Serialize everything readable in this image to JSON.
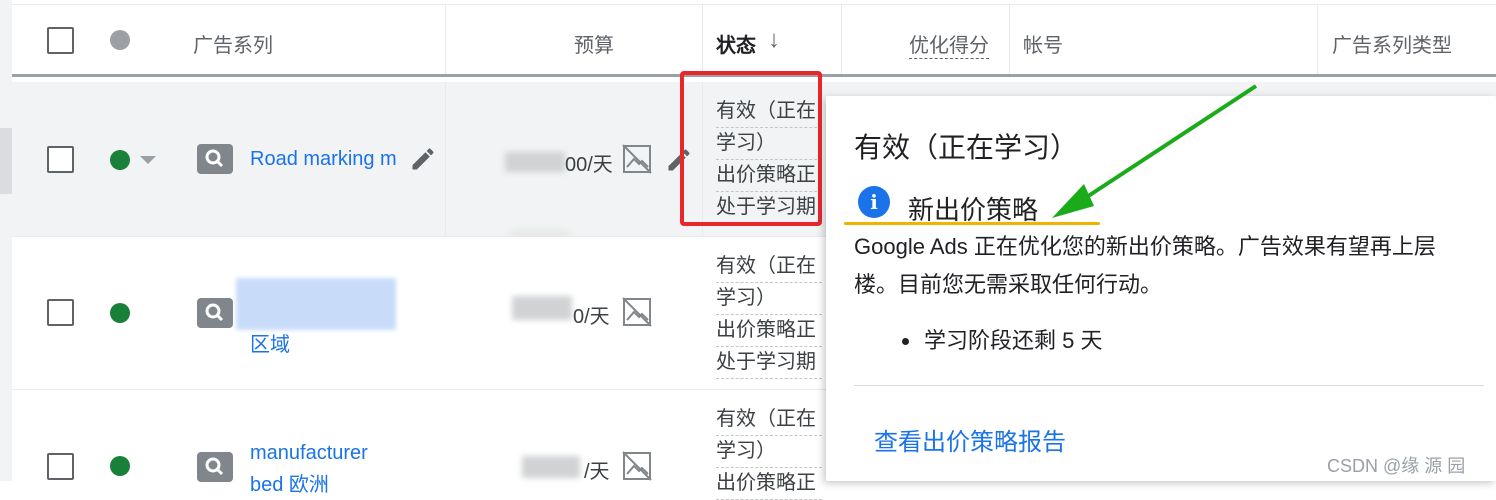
{
  "header": {
    "campaign_label": "广告系列",
    "budget_label": "预算",
    "status_label": "状态",
    "status_sort_glyph": "↓",
    "opt_score_label": "优化得分",
    "account_label": "帐号",
    "campaign_type_label": "广告系列类型"
  },
  "rows": [
    {
      "campaign_name": "Road marking m",
      "budget_suffix": "00/天",
      "status_lines": [
        "有效（正在",
        "学习）",
        "出价策略正",
        "处于学习期"
      ],
      "status_color": "#188038"
    },
    {
      "campaign_name_line2": "区域",
      "budget_suffix": "0/天",
      "status_lines": [
        "有效（正在",
        "学习）",
        "出价策略正",
        "处于学习期"
      ],
      "status_color": "#188038"
    },
    {
      "campaign_name": "manufacturer",
      "campaign_name_line2": "bed 欧洲",
      "budget_suffix": "/天",
      "status_lines": [
        "有效（正在",
        "学习）",
        "出价策略正"
      ],
      "status_color": "#188038"
    }
  ],
  "popup": {
    "title": "有效（正在学习）",
    "info_icon": "i",
    "subtitle": "新出价策略",
    "body_line1": "Google Ads 正在优化您的新出价策略。广告效果有望再上层",
    "body_line2": "楼。目前您无需采取任何行动。",
    "bullet": "学习阶段还剩 5 天",
    "link": "查看出价策略报告"
  },
  "watermark": "CSDN @缘  源  园",
  "colors": {
    "accent": "#1a73e8",
    "enabled_green": "#188038",
    "annotation_red": "#e8262b",
    "annotation_green": "#1aaa1a",
    "underline_yellow": "#f2b300"
  }
}
